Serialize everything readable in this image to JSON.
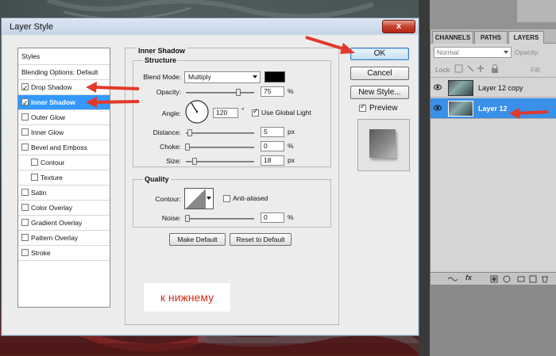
{
  "dialog": {
    "title": "Layer Style",
    "close_label": "x"
  },
  "styles_list": {
    "header": "Styles",
    "blending": "Blending Options: Default",
    "items": [
      {
        "label": "Drop Shadow",
        "checked": true,
        "selected": false,
        "indent": false
      },
      {
        "label": "Inner Shadow",
        "checked": true,
        "selected": true,
        "indent": false
      },
      {
        "label": "Outer Glow",
        "checked": false,
        "selected": false,
        "indent": false
      },
      {
        "label": "Inner Glow",
        "checked": false,
        "selected": false,
        "indent": false
      },
      {
        "label": "Bevel and Emboss",
        "checked": false,
        "selected": false,
        "indent": false
      },
      {
        "label": "Contour",
        "checked": false,
        "selected": false,
        "indent": true
      },
      {
        "label": "Texture",
        "checked": false,
        "selected": false,
        "indent": true
      },
      {
        "label": "Satin",
        "checked": false,
        "selected": false,
        "indent": false
      },
      {
        "label": "Color Overlay",
        "checked": false,
        "selected": false,
        "indent": false
      },
      {
        "label": "Gradient Overlay",
        "checked": false,
        "selected": false,
        "indent": false
      },
      {
        "label": "Pattern Overlay",
        "checked": false,
        "selected": false,
        "indent": false
      },
      {
        "label": "Stroke",
        "checked": false,
        "selected": false,
        "indent": false
      }
    ]
  },
  "inner_shadow": {
    "title": "Inner Shadow",
    "structure_title": "Structure",
    "blend_mode_label": "Blend Mode:",
    "blend_mode_value": "Multiply",
    "shadow_color": "#000000",
    "opacity_label": "Opacity:",
    "opacity_value": "75",
    "opacity_unit": "%",
    "angle_label": "Angle:",
    "angle_value": "120",
    "angle_unit": "°",
    "use_global_light_label": "Use Global Light",
    "use_global_light": true,
    "distance_label": "Distance:",
    "distance_value": "5",
    "distance_unit": "px",
    "choke_label": "Choke:",
    "choke_value": "0",
    "choke_unit": "%",
    "size_label": "Size:",
    "size_value": "18",
    "size_unit": "px",
    "quality_title": "Quality",
    "contour_label": "Contour:",
    "anti_aliased_label": "Anti-aliased",
    "anti_aliased": false,
    "noise_label": "Noise:",
    "noise_value": "0",
    "noise_unit": "%",
    "make_default_label": "Make Default",
    "reset_default_label": "Reset to Default"
  },
  "buttons": {
    "ok": "OK",
    "cancel": "Cancel",
    "new_style": "New Style...",
    "preview_label": "Preview",
    "preview_checked": true
  },
  "annotation": {
    "note": "к нижнему",
    "arrow_color": "#e03a2a"
  },
  "layers_panel": {
    "tabs": [
      "CHANNELS",
      "PATHS",
      "LAYERS"
    ],
    "active_tab": "LAYERS",
    "blend_mode": "Normal",
    "opacity_label": "Opacity:",
    "lock_label": "Lock:",
    "fill_label": "Fill:",
    "layers": [
      {
        "name": "Layer 12 copy",
        "selected": false
      },
      {
        "name": "Layer 12",
        "selected": true
      }
    ],
    "footer_fx": "fx"
  }
}
